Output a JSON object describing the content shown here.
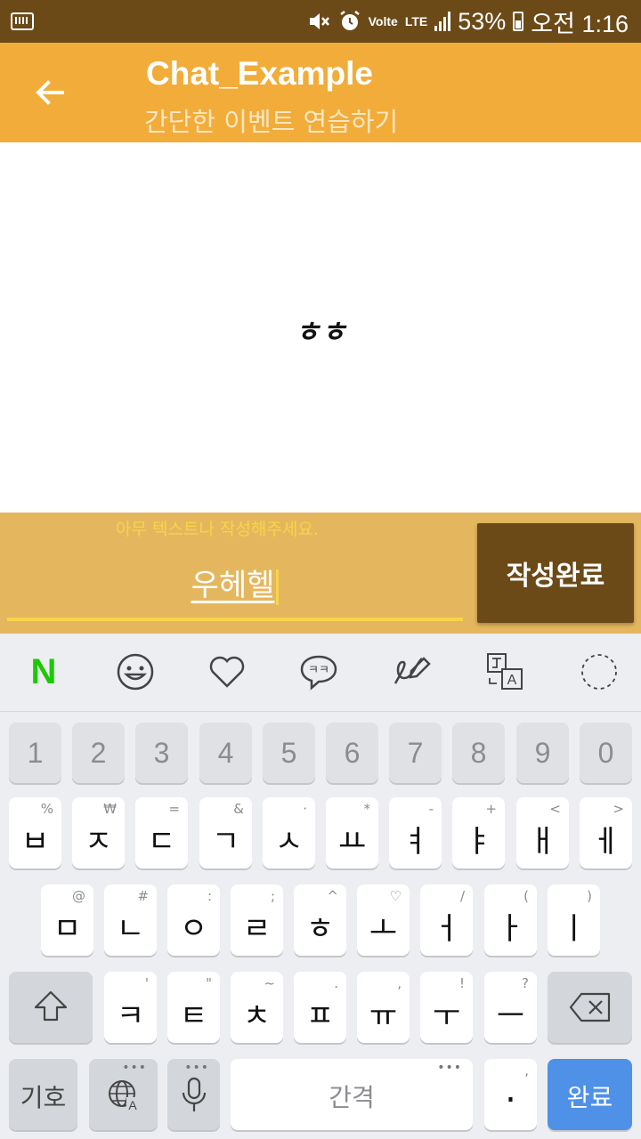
{
  "status_bar": {
    "volte": "Volte",
    "network": "LTE",
    "battery_percent": "53%",
    "time": "오전 1:16"
  },
  "app_bar": {
    "title": "Chat_Example",
    "subtitle": "간단한 이벤트 연습하기"
  },
  "content": {
    "message": "ㅎㅎ"
  },
  "input": {
    "hint": "아무 텍스트나 작성해주세요.",
    "value": "우헤헬",
    "submit_label": "작성완료"
  },
  "keyboard": {
    "toolbar_icons": [
      "naver-icon",
      "emoji-icon",
      "heart-icon",
      "chat-bubble-icon",
      "handwriting-icon",
      "translate-icon",
      "circle-icon"
    ],
    "naver_label": "N",
    "chat_bubble_label": "ㅋㅋ",
    "numbers": [
      "1",
      "2",
      "3",
      "4",
      "5",
      "6",
      "7",
      "8",
      "9",
      "0"
    ],
    "row1": [
      {
        "main": "ㅂ",
        "sub": "%"
      },
      {
        "main": "ㅈ",
        "sub": "₩"
      },
      {
        "main": "ㄷ",
        "sub": "="
      },
      {
        "main": "ㄱ",
        "sub": "&"
      },
      {
        "main": "ㅅ",
        "sub": "·"
      },
      {
        "main": "ㅛ",
        "sub": "*"
      },
      {
        "main": "ㅕ",
        "sub": "-"
      },
      {
        "main": "ㅑ",
        "sub": "+"
      },
      {
        "main": "ㅐ",
        "sub": "<"
      },
      {
        "main": "ㅔ",
        "sub": ">"
      }
    ],
    "row2": [
      {
        "main": "ㅁ",
        "sub": "@"
      },
      {
        "main": "ㄴ",
        "sub": "#"
      },
      {
        "main": "ㅇ",
        "sub": ":"
      },
      {
        "main": "ㄹ",
        "sub": ";"
      },
      {
        "main": "ㅎ",
        "sub": "^"
      },
      {
        "main": "ㅗ",
        "sub": "♡"
      },
      {
        "main": "ㅓ",
        "sub": "/"
      },
      {
        "main": "ㅏ",
        "sub": "("
      },
      {
        "main": "ㅣ",
        "sub": ")"
      }
    ],
    "row3": [
      {
        "main": "ㅋ",
        "sub": "'"
      },
      {
        "main": "ㅌ",
        "sub": "\""
      },
      {
        "main": "ㅊ",
        "sub": "~"
      },
      {
        "main": "ㅍ",
        "sub": "."
      },
      {
        "main": "ㅠ",
        "sub": ","
      },
      {
        "main": "ㅜ",
        "sub": "!"
      },
      {
        "main": "ㅡ",
        "sub": "?"
      }
    ],
    "symbols_label": "기호",
    "space_label": "간격",
    "period_label": ".",
    "period_sub": ",",
    "done_label": "완료",
    "accent_color": "#4e91e6"
  }
}
